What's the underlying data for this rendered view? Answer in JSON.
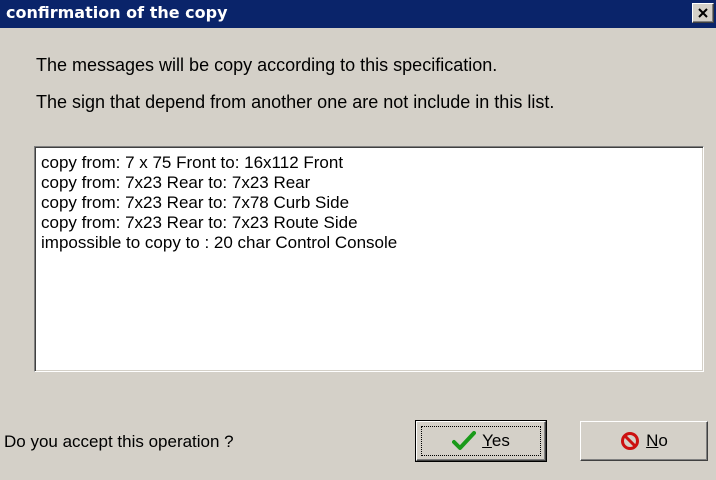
{
  "dialog": {
    "title": "confirmation of the copy",
    "message_line1": "The messages will be copy according to this specification.",
    "message_line2": "The sign that depend from another one are not include in this list.",
    "list_items": [
      "copy from: 7 x 75 Front to: 16x112 Front",
      "copy from: 7x23 Rear to: 7x23 Rear",
      "copy from: 7x23 Rear to: 7x78 Curb Side",
      "copy from: 7x23 Rear to: 7x23 Route Side",
      "impossible to copy to : 20 char Control Console"
    ],
    "question": "Do you accept this operation ?",
    "yes_button": {
      "mnemonic": "Y",
      "rest": "es",
      "icon": "checkmark-icon"
    },
    "no_button": {
      "mnemonic": "N",
      "rest": "o",
      "icon": "no-entry-icon"
    }
  },
  "colors": {
    "titlebar": "#0a246a",
    "face": "#d4d0c8",
    "check": "#1a9a1a",
    "no_sign": "#cc1010"
  }
}
